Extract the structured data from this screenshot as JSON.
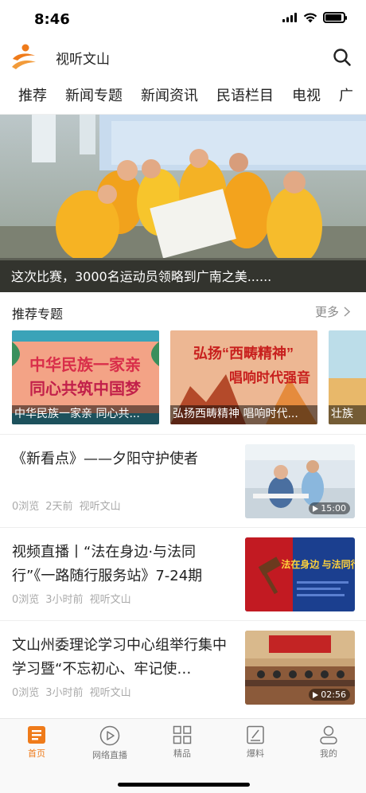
{
  "status": {
    "time": "8:46",
    "battery_level": 0.9
  },
  "header": {
    "title": "视听文山"
  },
  "tabs": [
    {
      "label": "推荐",
      "active": true
    },
    {
      "label": "新闻专题"
    },
    {
      "label": "新闻资讯"
    },
    {
      "label": "民语栏目"
    },
    {
      "label": "电视"
    },
    {
      "label": "广"
    }
  ],
  "hero": {
    "caption": "这次比赛，3000名运动员领略到广南之美......"
  },
  "topics_section": {
    "title": "推荐专题",
    "more": "更多",
    "cards": [
      {
        "label": "中华民族一家亲  同心共...",
        "banner_line1": "中华民族一家亲",
        "banner_line2": "同心共筑中国梦"
      },
      {
        "label": "弘扬西畴精神 唱响时代...",
        "banner_line1": "弘扬“西畴精神”",
        "banner_line2": "唱响时代强音"
      },
      {
        "label": "壮族"
      }
    ]
  },
  "news": [
    {
      "title": "《新看点》——夕阳守护使者",
      "views": "0浏览",
      "time": "2天前",
      "source": "视听文山",
      "duration": "15:00"
    },
    {
      "title": "视频直播丨“法在身边·与法同行”《一路随行服务站》7-24期",
      "views": "0浏览",
      "time": "3小时前",
      "source": "视听文山",
      "thumb_text": "法在身边 与法同行"
    },
    {
      "title": "文山州委理论学习中心组举行集中学习暨“不忘初心、牢记使…",
      "views": "0浏览",
      "time": "3小时前",
      "source": "视听文山",
      "duration": "02:56"
    }
  ],
  "bottom_nav": [
    {
      "label": "首页",
      "icon": "home-icon",
      "active": true
    },
    {
      "label": "网络直播",
      "icon": "play-icon"
    },
    {
      "label": "精品",
      "icon": "grid-icon"
    },
    {
      "label": "爆料",
      "icon": "edit-icon"
    },
    {
      "label": "我的",
      "icon": "user-icon"
    }
  ],
  "colors": {
    "accent": "#ef7b1a",
    "text": "#222222",
    "muted": "#aaaaaa"
  }
}
